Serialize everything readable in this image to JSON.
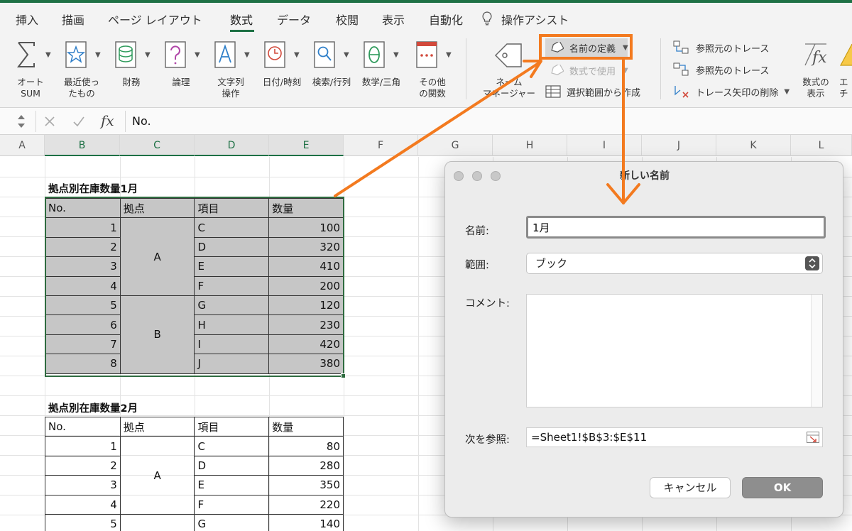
{
  "ribbon_tabs": [
    "挿入",
    "描画",
    "ページ レイアウト",
    "数式",
    "データ",
    "校閲",
    "表示",
    "自動化",
    "操作アシスト"
  ],
  "active_tab": "数式",
  "ribbon": {
    "autosum": "オート\nSUM",
    "recent": "最近使っ\nたもの",
    "financial": "財務",
    "logical": "論理",
    "text": "文字列\n操作",
    "datetime": "日付/時刻",
    "lookup": "検索/行列",
    "math": "数学/三角",
    "more": "その他\nの関数",
    "name_manager": "ネーム\nマネージャー",
    "define_name": "名前の定義",
    "use_in_formula": "数式で使用",
    "create_from_selection": "選択範囲から作成",
    "trace_precedents": "参照元のトレース",
    "trace_dependents": "参照先のトレース",
    "remove_arrows": "トレース矢印の削除",
    "show_formulas": "数式の\n表示",
    "error_check_partial": "エ\nチ"
  },
  "formula_bar": {
    "fx": "fx",
    "value": "No."
  },
  "columns": [
    "A",
    "B",
    "C",
    "D",
    "E",
    "F",
    "G",
    "H",
    "I",
    "J",
    "K",
    "L"
  ],
  "sheet": {
    "table1": {
      "title": "拠点別在庫数量1月",
      "headers": [
        "No.",
        "拠点",
        "項目",
        "数量"
      ],
      "rows": [
        {
          "no": "1",
          "item": "C",
          "qty": "100"
        },
        {
          "no": "2",
          "item": "D",
          "qty": "320"
        },
        {
          "no": "3",
          "item": "E",
          "qty": "410"
        },
        {
          "no": "4",
          "item": "F",
          "qty": "200"
        },
        {
          "no": "5",
          "item": "G",
          "qty": "120"
        },
        {
          "no": "6",
          "item": "H",
          "qty": "230"
        },
        {
          "no": "7",
          "item": "I",
          "qty": "420"
        },
        {
          "no": "8",
          "item": "J",
          "qty": "380"
        }
      ],
      "bases": [
        "A",
        "B"
      ]
    },
    "table2": {
      "title": "拠点別在庫数量2月",
      "headers": [
        "No.",
        "拠点",
        "項目",
        "数量"
      ],
      "rows": [
        {
          "no": "1",
          "item": "C",
          "qty": "80"
        },
        {
          "no": "2",
          "item": "D",
          "qty": "280"
        },
        {
          "no": "3",
          "item": "E",
          "qty": "350"
        },
        {
          "no": "4",
          "item": "F",
          "qty": "220"
        },
        {
          "no": "5",
          "item": "G",
          "qty": "140"
        }
      ],
      "bases": [
        "A"
      ]
    }
  },
  "dialog": {
    "title": "新しい名前",
    "name_label": "名前:",
    "name_value": "1月",
    "scope_label": "範囲:",
    "scope_value": "ブック",
    "comment_label": "コメント:",
    "refers_label": "次を参照:",
    "refers_value": "=Sheet1!$B$3:$E$11",
    "cancel": "キャンセル",
    "ok": "OK"
  },
  "colors": {
    "excel_green": "#1e7145",
    "annotation_orange": "#f37a1f",
    "table_fill": "#c6c6c6"
  }
}
